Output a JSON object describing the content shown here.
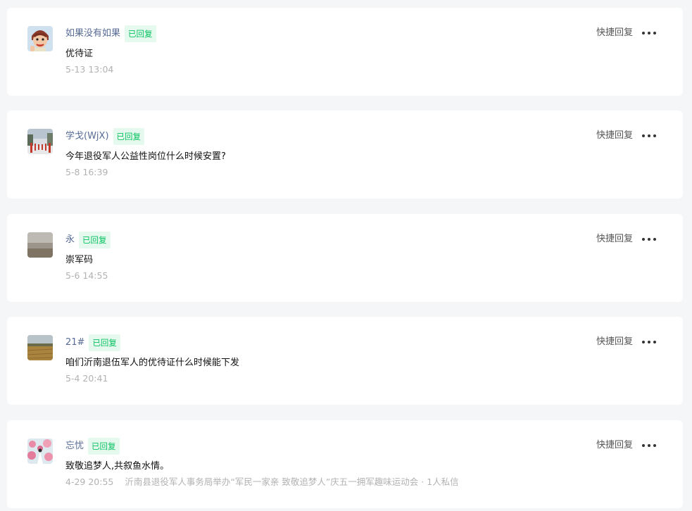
{
  "comments": [
    {
      "user": "如果没有如果",
      "badge": "已回复",
      "text": "优待证",
      "time": "5-13 13:04",
      "source": "",
      "quick_reply": "快捷回复",
      "avatar": "cartoon-character-avatar"
    },
    {
      "user": "学戈(WjX)",
      "badge": "已回复",
      "text": "今年退役军人公益性岗位什么时候安置?",
      "time": "5-8 16:39",
      "source": "",
      "quick_reply": "快捷回复",
      "avatar": "street-photo-avatar"
    },
    {
      "user": "永",
      "badge": "已回复",
      "text": "崇军码",
      "time": "5-6 14:55",
      "source": "",
      "quick_reply": "快捷回复",
      "avatar": "sea-landscape-avatar"
    },
    {
      "user": "21#",
      "badge": "已回复",
      "text": "咱们沂南退伍军人的优待证什么时候能下发",
      "time": "5-4 20:41",
      "source": "",
      "quick_reply": "快捷回复",
      "avatar": "wheat-field-avatar"
    },
    {
      "user": "忘忧",
      "badge": "已回复",
      "text": "致敬追梦人,共叙鱼水情。",
      "time": "4-29 20:55",
      "source": "沂南县退役军人事务局举办“军民一家亲 致敬追梦人”庆五一拥军趣味运动会 · 1人私信",
      "quick_reply": "快捷回复",
      "avatar": "flower-garden-avatar"
    }
  ]
}
